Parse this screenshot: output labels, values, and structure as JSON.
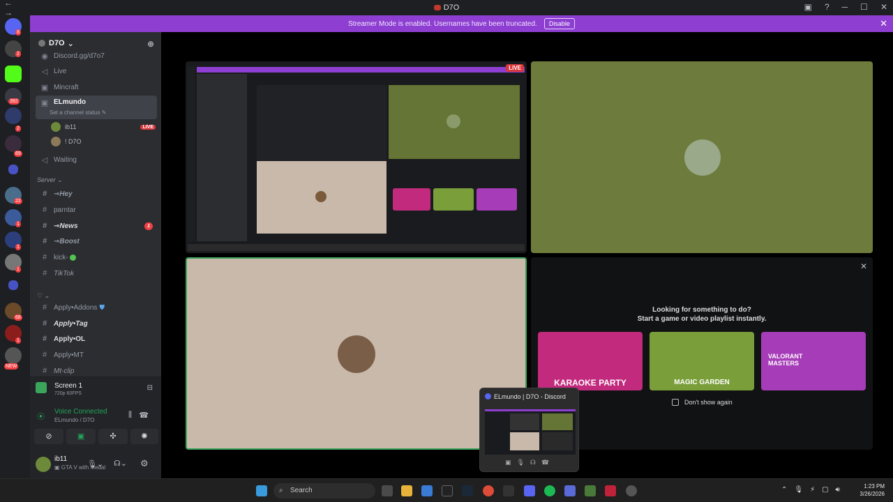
{
  "window": {
    "nav_glyphs": "← →",
    "title": "D7O",
    "controls": [
      "▣",
      "?",
      "─",
      "☐",
      "✕"
    ]
  },
  "guilds": {
    "badges": [
      "8",
      "2",
      "392",
      "2",
      "69",
      "22",
      "1",
      "1",
      "1",
      "68",
      "1",
      "NEW"
    ]
  },
  "banner": {
    "text": "Streamer Mode is enabled. Usernames have been truncated.",
    "disable_label": "Disable",
    "close_glyph": "✕"
  },
  "sidebar": {
    "server_name": "D7O",
    "server_chevron": "⌄",
    "top_link": "Discord.gg/d7o7",
    "channels": {
      "live": "Live",
      "mincraft": "Mincraft",
      "elmundo": "ELmundo",
      "elmundo_status": "Set a channel status",
      "user1": "ib11",
      "user1_badge": "LIVE",
      "user2": "! D7O",
      "waiting": "Waiting",
      "category_server": "Server",
      "hey": "⊸Hey",
      "parntar": "parntar",
      "news": "⊸News",
      "news_badge": "1",
      "boost": "⊸Boost",
      "kick": "kick-",
      "tiktok": "TikTok",
      "category_heart": "♡ ⌄",
      "addons": "Apply•Addons",
      "tag": "Apply•Tag",
      "ol": "Apply•OL",
      "mt": "Apply•MT",
      "clip": "Mt-clip"
    }
  },
  "rtc": {
    "screen_title": "Screen 1",
    "screen_sub": "720p 60FPS",
    "voice_status": "Voice Connected",
    "voice_channel": "ELmundo / D7O",
    "username": "ib11",
    "user_status": "GTA V with Medal"
  },
  "stage": {
    "activity_title": "Looking for something to do?",
    "activity_subtitle": "Start a game or video playlist instantly.",
    "games": [
      "Karaoke Party",
      "Magic Garden",
      "VALORANT MASTERS"
    ],
    "game_overlay_text": [
      "KARAOKE PARTY",
      "MAGIC GARDEN",
      "VALORANT MASTERS"
    ],
    "dont_show": "Don't show again",
    "live_badge": "LIVE"
  },
  "taskbar": {
    "search_placeholder": "Search",
    "time": "1:23 PM",
    "date": "3/26/2026",
    "preview_title": "ELmundo | D7O - Discord"
  },
  "colors": {
    "banner": "#8e3fd1",
    "green_tile": "#6d7c3c",
    "beige_tile": "#c9b9aa",
    "live_red": "#da373c"
  }
}
